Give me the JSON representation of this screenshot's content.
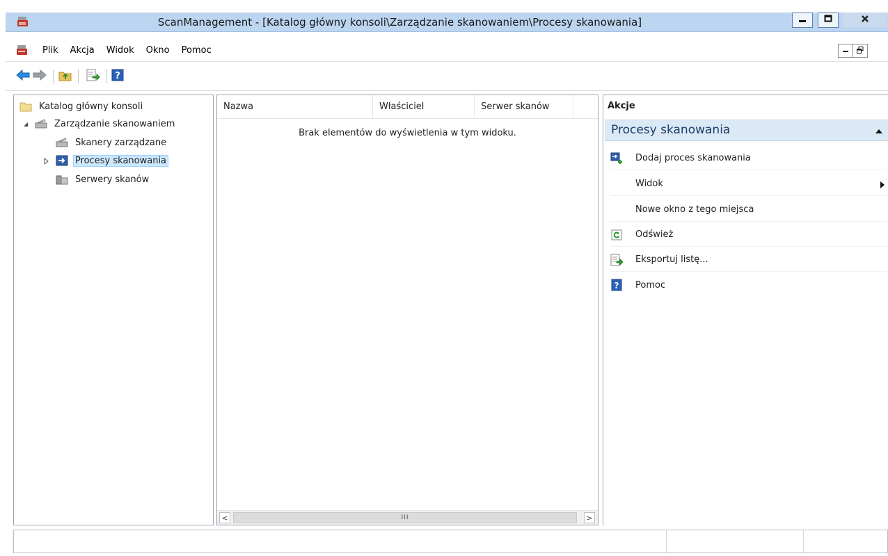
{
  "window": {
    "title": "ScanManagement - [Katalog główny konsoli\\Zarządzanie skanowaniem\\Procesy skanowania]",
    "icons": [
      "app-icon",
      "minimize-icon",
      "maximize-icon",
      "close-icon"
    ]
  },
  "menu": {
    "items": [
      "Plik",
      "Akcja",
      "Widok",
      "Okno",
      "Pomoc"
    ]
  },
  "toolbar": {
    "buttons": [
      "back-arrow-icon",
      "forward-arrow-icon",
      "up-folder-icon",
      "export-list-icon",
      "help-icon"
    ]
  },
  "tree": {
    "root": "Katalog główny konsoli",
    "scan_management": "Zarządzanie skanowaniem",
    "managed_scanners": "Skanery zarządzane",
    "scan_processes": "Procesy skanowania",
    "scan_servers": "Serwery skanów",
    "selected": "Procesy skanowania"
  },
  "list": {
    "columns": [
      "Nazwa",
      "Właściciel",
      "Serwer skanów"
    ],
    "empty_message": "Brak elementów do wyświetlenia w tym widoku.",
    "scroll_left": "<",
    "scroll_right": ">",
    "thumb_grip": "III"
  },
  "actions": {
    "title": "Akcje",
    "section": "Procesy skanowania",
    "items": [
      {
        "label": "Dodaj proces skanowania",
        "icon": "add-process-icon"
      },
      {
        "label": "Widok",
        "icon": "",
        "submenu": true
      },
      {
        "label": "Nowe okno z tego miejsca",
        "icon": ""
      },
      {
        "label": "Odśwież",
        "icon": "refresh-icon"
      },
      {
        "label": "Eksportuj listę...",
        "icon": "export-list-icon"
      },
      {
        "label": "Pomoc",
        "icon": "help-icon"
      }
    ]
  },
  "colors": {
    "titlebar": "#bcd5f0",
    "selection": "#cce8ff",
    "actions_section": "#dbe8f6",
    "accent_blue": "#2a61b5"
  }
}
